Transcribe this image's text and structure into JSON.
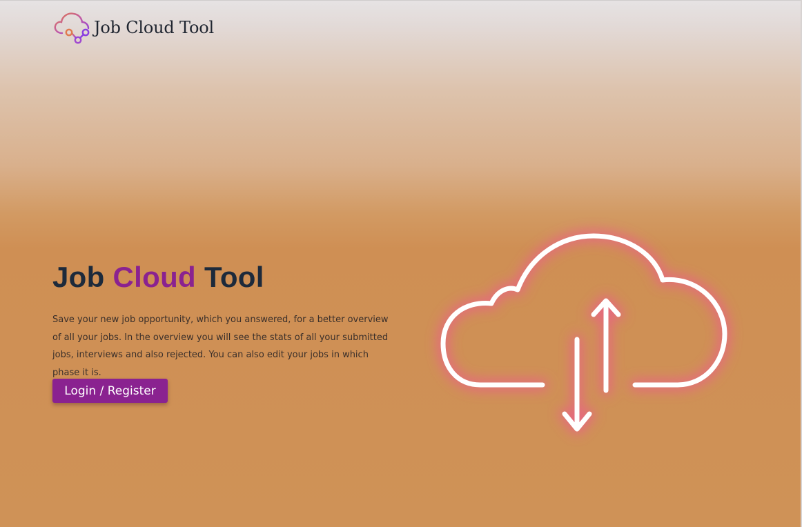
{
  "header": {
    "brand_name": "Job Cloud Tool",
    "logo_icon": "cloud-network-icon"
  },
  "hero": {
    "title_part1": "Job ",
    "title_accent": "Cloud",
    "title_part2": " Tool",
    "description": "Save your new job opportunity, which you answered, for a better overview of all your jobs. In the overview you will see the stats of all your submitted jobs, interviews and also rejected. You can also edit your jobs in which phase it is.",
    "cta_label": "Login / Register",
    "illustration_icon": "cloud-upload-download-icon"
  },
  "colors": {
    "accent": "#8a2290",
    "title": "#1d2a3b",
    "background": "#cf9257"
  }
}
